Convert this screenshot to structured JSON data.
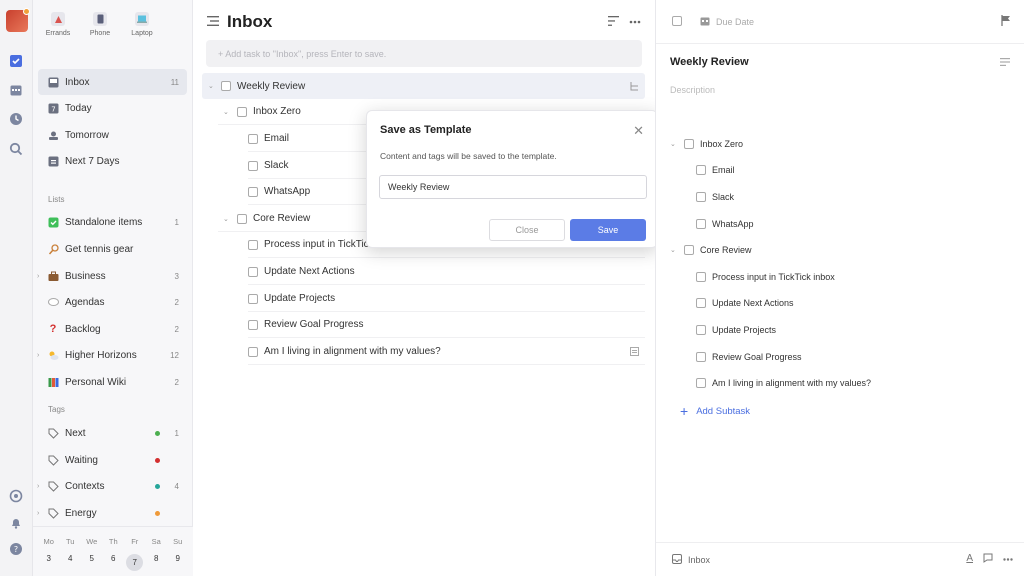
{
  "devices": [
    {
      "label": "Errands",
      "icon": "errands-icon"
    },
    {
      "label": "Phone",
      "icon": "phone-icon"
    },
    {
      "label": "Laptop",
      "icon": "laptop-icon"
    }
  ],
  "smart_lists": [
    {
      "label": "Inbox",
      "count": "11",
      "icon": "inbox-icon"
    },
    {
      "label": "Today",
      "count": "",
      "icon": "today-icon"
    },
    {
      "label": "Tomorrow",
      "count": "",
      "icon": "tomorrow-icon"
    },
    {
      "label": "Next 7 Days",
      "count": "",
      "icon": "next7days-icon"
    }
  ],
  "lists_label": "Lists",
  "lists": [
    {
      "label": "Standalone items",
      "count": "1",
      "icon": "green-check-icon"
    },
    {
      "label": "Get tennis gear",
      "count": "",
      "icon": "tennis-icon"
    },
    {
      "label": "Business",
      "count": "3",
      "icon": "briefcase-icon"
    },
    {
      "label": "Agendas",
      "count": "2",
      "icon": "speech-bubble-icon"
    },
    {
      "label": "Backlog",
      "count": "2",
      "icon": "question-mark-icon"
    },
    {
      "label": "Higher Horizons",
      "count": "12",
      "icon": "sun-cloud-icon"
    },
    {
      "label": "Personal Wiki",
      "count": "2",
      "icon": "books-icon"
    }
  ],
  "tags_label": "Tags",
  "tags": [
    {
      "label": "Next",
      "count": "1",
      "color": "#4caf50"
    },
    {
      "label": "Waiting",
      "count": "",
      "color": "#d32f2f"
    },
    {
      "label": "Contexts",
      "count": "4",
      "color": "#26a69a"
    },
    {
      "label": "Energy",
      "count": "",
      "color": "#ef9a3a"
    }
  ],
  "calendar": {
    "days": [
      "Mo",
      "Tu",
      "We",
      "Th",
      "Fr",
      "Sa",
      "Su"
    ],
    "dates": [
      "3",
      "4",
      "5",
      "6",
      "7",
      "8",
      "9"
    ],
    "today_index": 4
  },
  "main": {
    "title": "Inbox",
    "add_placeholder": "+ Add task to \"Inbox\", press Enter to save.",
    "tasks": [
      {
        "label": "Weekly Review"
      },
      {
        "label": "Inbox Zero"
      },
      {
        "label": "Email"
      },
      {
        "label": "Slack"
      },
      {
        "label": "WhatsApp"
      },
      {
        "label": "Core Review"
      },
      {
        "label": "Process input in TickTick inbox"
      },
      {
        "label": "Update Next Actions"
      },
      {
        "label": "Update Projects"
      },
      {
        "label": "Review Goal Progress"
      },
      {
        "label": "Am I living in alignment with my values?"
      }
    ]
  },
  "modal": {
    "title": "Save as Template",
    "description": "Content and tags will be saved to the template.",
    "input_value": "Weekly Review",
    "close_label": "Close",
    "save_label": "Save",
    "accent": "#5b7ce6"
  },
  "detail": {
    "due_label": "Due Date",
    "title": "Weekly Review",
    "description_placeholder": "Description",
    "subtasks": [
      {
        "label": "Inbox Zero"
      },
      {
        "label": "Email"
      },
      {
        "label": "Slack"
      },
      {
        "label": "WhatsApp"
      },
      {
        "label": "Core Review"
      },
      {
        "label": "Process input in TickTick inbox"
      },
      {
        "label": "Update Next Actions"
      },
      {
        "label": "Update Projects"
      },
      {
        "label": "Review Goal Progress"
      },
      {
        "label": "Am I living in alignment with my values?"
      }
    ],
    "add_subtask_label": "Add Subtask",
    "footer_list": "Inbox"
  }
}
